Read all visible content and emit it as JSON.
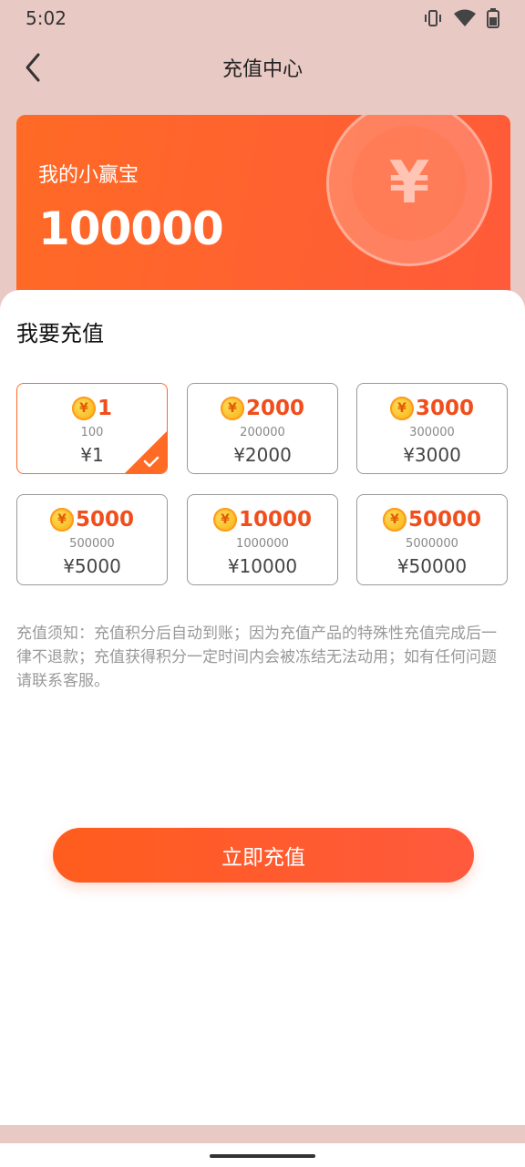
{
  "status": {
    "time": "5:02"
  },
  "nav": {
    "title": "充值中心"
  },
  "card": {
    "label": "我的小赢宝",
    "value": "100000",
    "symbol": "¥"
  },
  "section": {
    "title": "我要充值"
  },
  "options": [
    {
      "amount": "1",
      "points": "100",
      "price": "¥1",
      "selected": true
    },
    {
      "amount": "2000",
      "points": "200000",
      "price": "¥2000",
      "selected": false
    },
    {
      "amount": "3000",
      "points": "300000",
      "price": "¥3000",
      "selected": false
    },
    {
      "amount": "5000",
      "points": "500000",
      "price": "¥5000",
      "selected": false
    },
    {
      "amount": "10000",
      "points": "1000000",
      "price": "¥10000",
      "selected": false
    },
    {
      "amount": "50000",
      "points": "5000000",
      "price": "¥50000",
      "selected": false
    }
  ],
  "coin_symbol": "¥",
  "notice": "充值须知：充值积分后自动到账；因为充值产品的特殊性充值完成后一律不退款；充值获得积分一定时间内会被冻结无法动用；如有任何问题请联系客服。",
  "submit": {
    "label": "立即充值"
  },
  "colors": {
    "accent": "#ff6a25",
    "amount": "#f04e1c"
  }
}
